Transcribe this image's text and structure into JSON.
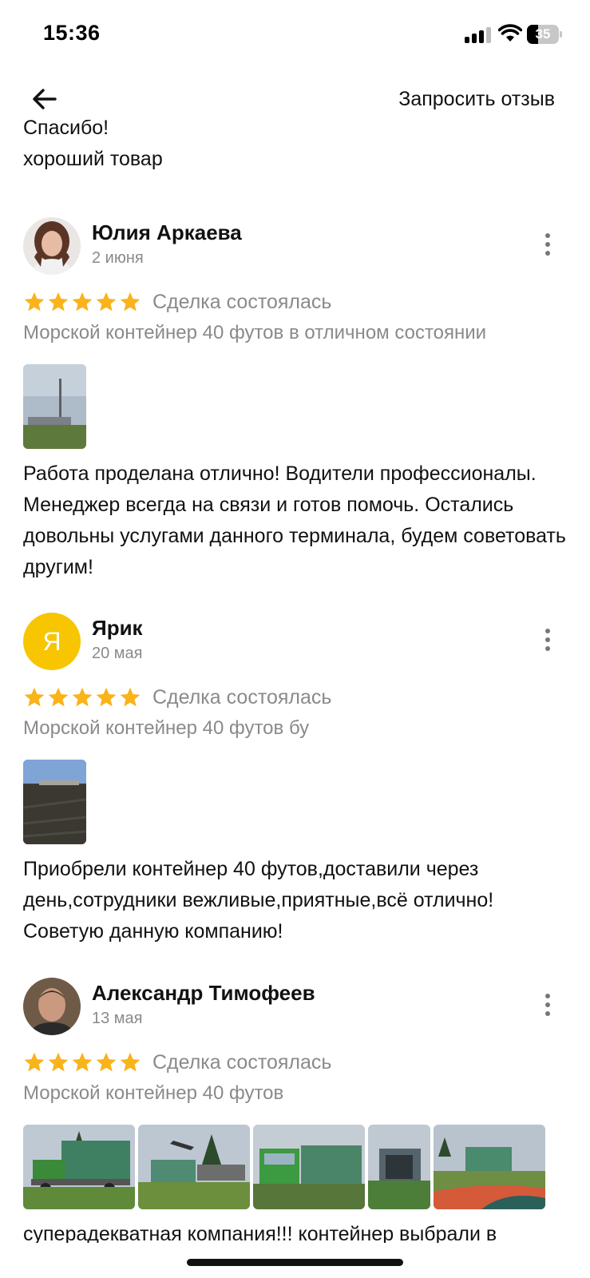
{
  "status_bar": {
    "time": "15:36",
    "battery": "35"
  },
  "header": {
    "request_review": "Запросить отзыв"
  },
  "previous_review_tail": {
    "line1": "Спасибо!",
    "line2": "хороший товар"
  },
  "reviews": [
    {
      "author": "Юлия Аркаева",
      "date": "2 июня",
      "rating": 5,
      "deal_status": "Сделка состоялась",
      "product": "Морской контейнер 40 футов в отличном состоянии",
      "text": "Работа проделана отлично! Водители профессионалы. Менеджер всегда на связи и готов помочь. Остались довольны услугами данного терминала, будем советовать другим!"
    },
    {
      "author": "Ярик",
      "avatar_letter": "Я",
      "date": "20 мая",
      "rating": 5,
      "deal_status": "Сделка состоялась",
      "product": "Морской контейнер 40 футов бу",
      "text": "Приобрели контейнер 40 футов,доставили через день,сотрудники вежливые,приятные,всё отлично! Советую данную компанию!"
    },
    {
      "author": "Александр Тимофеев",
      "date": "13 мая",
      "rating": 5,
      "deal_status": "Сделка состоялась",
      "product": "Морской контейнер 40 футов",
      "text": "суперадекватная компания!!! контейнер выбрали в"
    }
  ],
  "colors": {
    "star": "#f9b31b",
    "avatar_letter_bg": "#f7c600",
    "muted_text": "#8a8a8a"
  }
}
